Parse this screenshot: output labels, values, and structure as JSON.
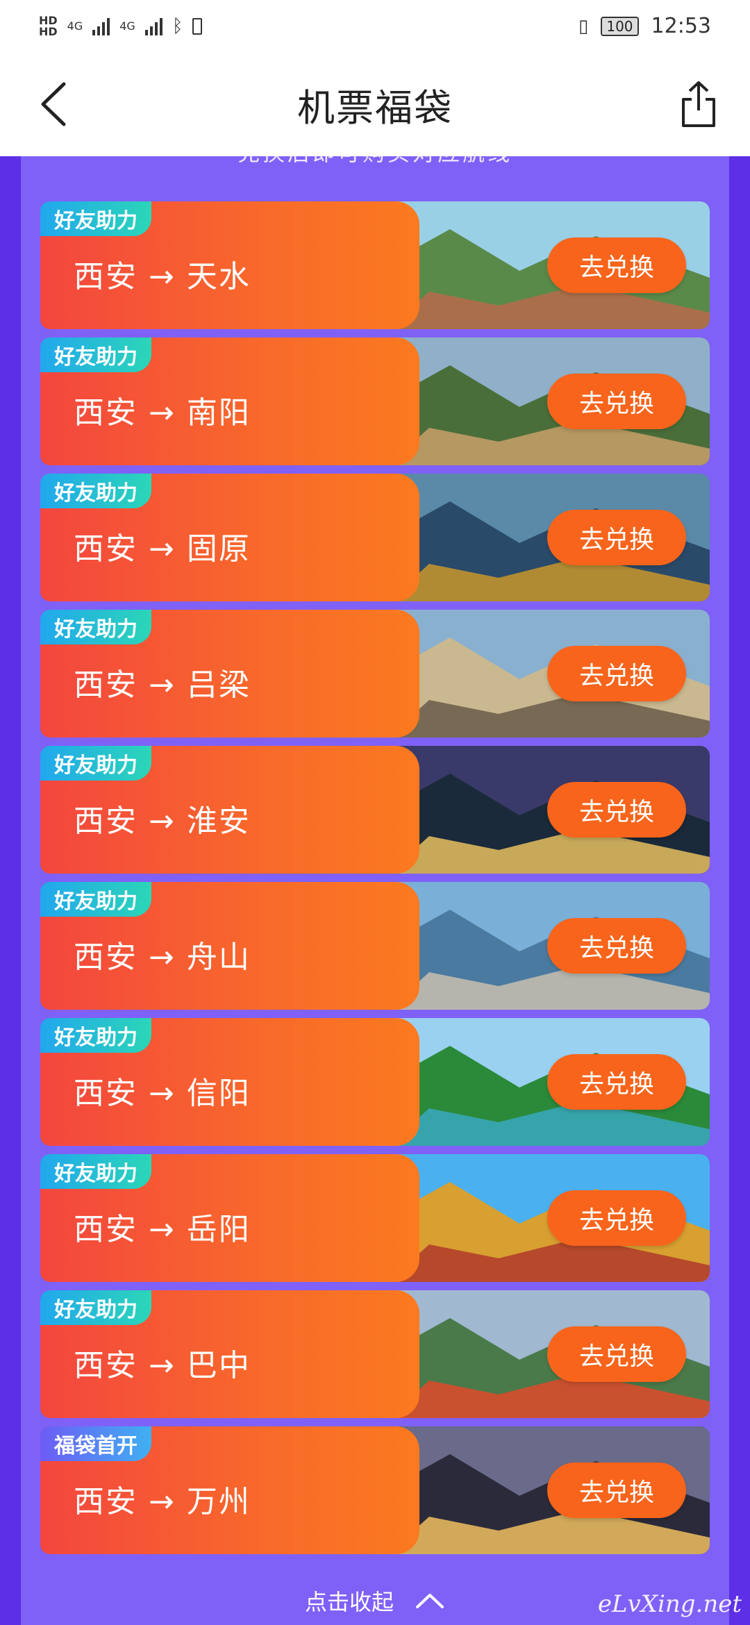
{
  "status_bar": {
    "hd1": "HD",
    "hd2": "HD",
    "net1": "4G",
    "net2": "4G",
    "battery": "100",
    "time": "12:53"
  },
  "header": {
    "title": "机票福袋"
  },
  "partial_text": "兑换后即可购买对应航线",
  "cards": [
    {
      "tag": "好友助力",
      "route": "西安 → 天水",
      "button": "去兑换"
    },
    {
      "tag": "好友助力",
      "route": "西安 → 南阳",
      "button": "去兑换"
    },
    {
      "tag": "好友助力",
      "route": "西安 → 固原",
      "button": "去兑换"
    },
    {
      "tag": "好友助力",
      "route": "西安 → 吕梁",
      "button": "去兑换"
    },
    {
      "tag": "好友助力",
      "route": "西安 → 淮安",
      "button": "去兑换"
    },
    {
      "tag": "好友助力",
      "route": "西安 → 舟山",
      "button": "去兑换"
    },
    {
      "tag": "好友助力",
      "route": "西安 → 信阳",
      "button": "去兑换"
    },
    {
      "tag": "好友助力",
      "route": "西安 → 岳阳",
      "button": "去兑换"
    },
    {
      "tag": "好友助力",
      "route": "西安 → 巴中",
      "button": "去兑换"
    },
    {
      "tag": "福袋首开",
      "route": "西安 → 万州",
      "button": "去兑换"
    }
  ],
  "footer": {
    "collapse_label": "点击收起"
  },
  "watermark": "eLvXing.net",
  "colors": {
    "page_bg": "#6a3df0",
    "panel": "#8061f7",
    "route_gradient_start": "#f3463f",
    "route_gradient_end": "#fb7a1f",
    "tag_teal": "#2bd6b7",
    "button": "#f8641b"
  },
  "icons": {
    "back": "chevron-left-icon",
    "share": "share-icon",
    "collapse": "chevron-up-icon"
  }
}
